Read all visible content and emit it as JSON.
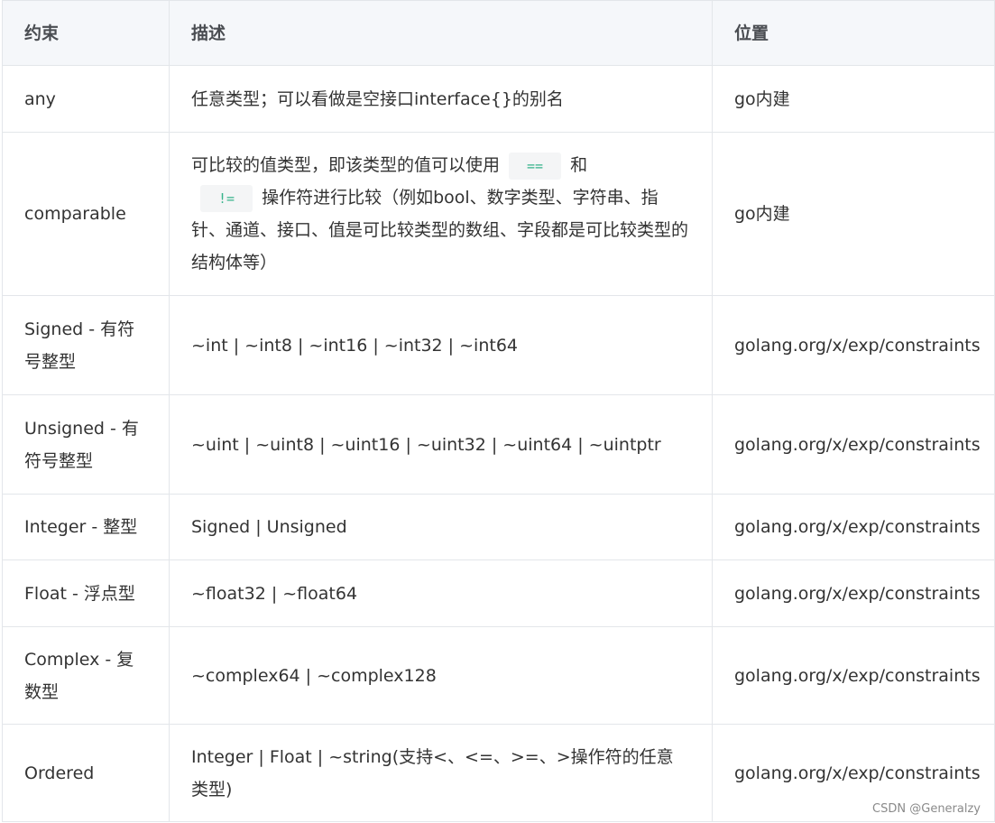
{
  "headers": [
    "约束",
    "描述",
    "位置"
  ],
  "rows": [
    {
      "constraint": "any",
      "description": "任意类型；可以看做是空接口interface{}的别名",
      "location": "go内建"
    },
    {
      "constraint": "comparable",
      "desc_parts": [
        "可比较的值类型，即该类型的值可以使用",
        "==",
        "和",
        "!=",
        "操作符进行比较（例如bool、数字类型、字符串、指针、通道、接口、值是可比较类型的数组、字段都是可比较类型的结构体等）"
      ],
      "location": "go内建"
    },
    {
      "constraint": "Signed - 有符号整型",
      "description": "~int | ~int8 | ~int16 | ~int32 | ~int64",
      "location": "golang.org/x/exp/constraints"
    },
    {
      "constraint": "Unsigned - 有符号整型",
      "description": "~uint | ~uint8 | ~uint16 | ~uint32 | ~uint64 | ~uintptr",
      "location": "golang.org/x/exp/constraints"
    },
    {
      "constraint": "Integer - 整型",
      "description": "Signed | Unsigned",
      "location": "golang.org/x/exp/constraints"
    },
    {
      "constraint": "Float - 浮点型",
      "description": "~float32 | ~float64",
      "location": "golang.org/x/exp/constraints"
    },
    {
      "constraint": "Complex - 复数型",
      "description": "~complex64 | ~complex128",
      "location": "golang.org/x/exp/constraints"
    },
    {
      "constraint": "Ordered",
      "description": "Integer | Float | ~string(支持<、<=、>=、>操作符的任意类型)",
      "location": "golang.org/x/exp/constraints"
    }
  ],
  "watermark": "CSDN @Generalzy"
}
